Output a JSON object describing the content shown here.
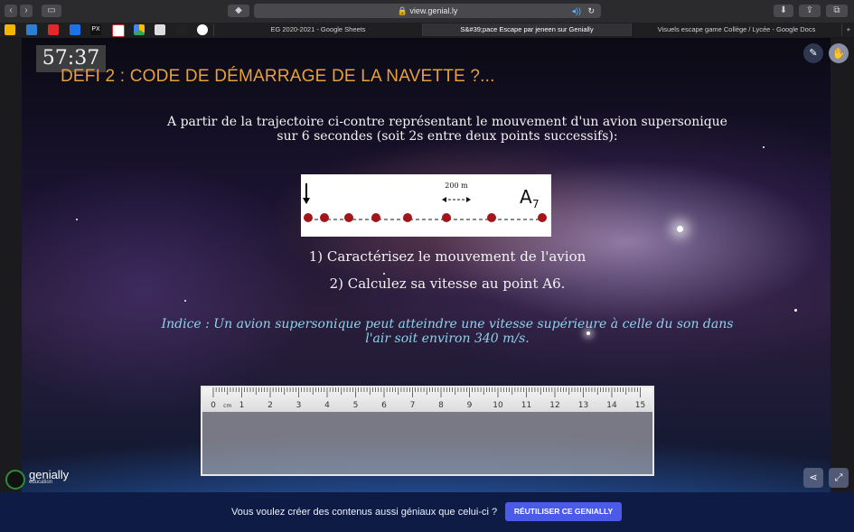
{
  "browser": {
    "url": "view.genial.ly",
    "tabs": [
      {
        "label": "EG 2020-2021 - Google Sheets"
      },
      {
        "label": "S&#39;pace Escape par jeneen sur Genially"
      },
      {
        "label": "Visuels escape game Collège / Lycée - Google Docs"
      }
    ],
    "new_tab": "+"
  },
  "slide": {
    "timer": "57:37",
    "title": "DEFI 2 : CODE DE DÉMARRAGE DE LA NAVETTE ?...",
    "intro_line1": "A partir de la trajectoire ci-contre  représentant le mouvement d'un avion supersonique",
    "intro_line2": "sur 6 secondes (soit 2s entre deux points successifs):",
    "figure": {
      "scale_label": "200 m",
      "point_label": "A",
      "point_sub": "7"
    },
    "question1": "1) Caractérisez le mouvement de l'avion",
    "question2": "2) Calculez sa vitesse au point A6.",
    "hint_line1": "Indice : Un avion supersonique peut atteindre une vitesse supérieure à celle du son dans",
    "hint_line2": "l'air  soit environ 340 m/s.",
    "ruler": {
      "unit": "cm",
      "numbers": [
        "0",
        "1",
        "2",
        "3",
        "4",
        "5",
        "6",
        "7",
        "8",
        "9",
        "10",
        "11",
        "12",
        "13",
        "14",
        "15"
      ]
    }
  },
  "brand": {
    "logo": "genially",
    "sub": "education"
  },
  "footer": {
    "text": "Vous voulez créer des contenus aussi géniaux que celui-ci ?",
    "button": "RÉUTILISER CE GENIALLY"
  },
  "colors": {
    "title": "#e8a13a",
    "hint": "#8fd0ec",
    "footer_bg": "#0d1b45",
    "cta": "#4b5be8",
    "marker": "#a3141b"
  }
}
